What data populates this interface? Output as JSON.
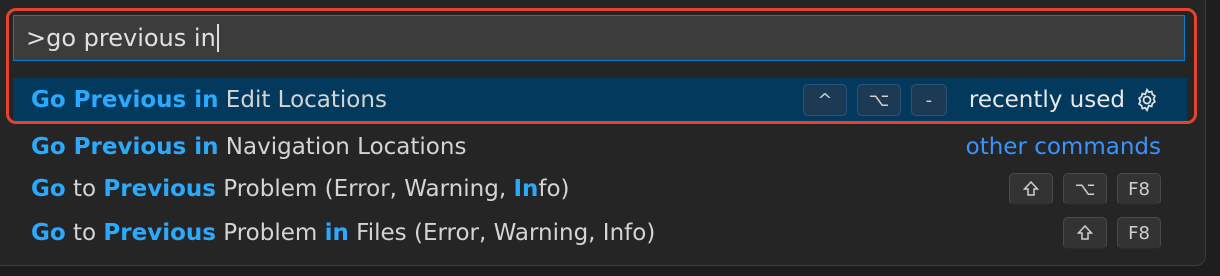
{
  "input": {
    "value": ">go previous in"
  },
  "rows": [
    {
      "prefix": "Go Previous in",
      "suffix": " Edit Locations",
      "keys": [
        "^",
        "⌥",
        "-"
      ],
      "description": "recently used",
      "icon": "gear-icon"
    },
    {
      "prefix": "Go Previous in",
      "suffix": " Navigation Locations",
      "link": "other commands"
    },
    {
      "parts": [
        "Go",
        " to ",
        "Previous",
        " Problem (Error, Warning, ",
        "In",
        "fo)"
      ],
      "keys": [
        "shift",
        "⌥",
        "F8"
      ]
    },
    {
      "parts": [
        "Go",
        " to ",
        "Previous",
        " Problem ",
        "in",
        " Files (Error, Warning, Info)"
      ],
      "keys": [
        "shift",
        "F8"
      ]
    }
  ],
  "colors": {
    "background": "#252526",
    "selection": "#04395e",
    "match_highlight": "#2aaaff",
    "focus_border": "#007fd4",
    "annotation_frame": "#e5432f",
    "link": "#3794ff"
  }
}
